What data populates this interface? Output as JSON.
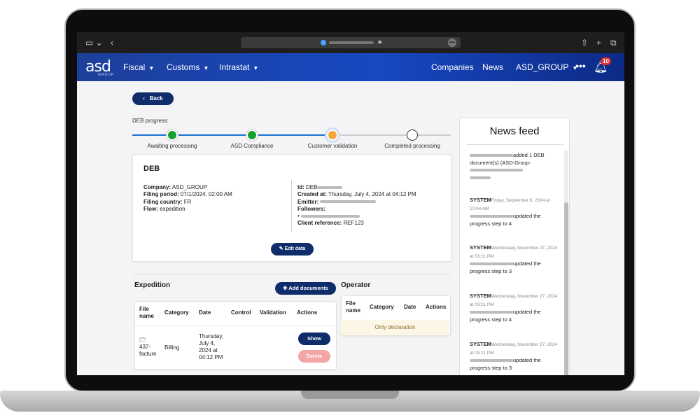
{
  "nav": {
    "logo": "asd",
    "logo_sub": "GROUP",
    "fiscal": "Fiscal",
    "customs": "Customs",
    "intrastat": "Intrastat",
    "companies": "Companies",
    "news": "News",
    "group": "ASD_GROUP",
    "more": "•••",
    "notifications": "10"
  },
  "page": {
    "back": "Back",
    "progress_label": "DEB progress:",
    "steps": [
      {
        "label": "Awaiting processing",
        "state": "done",
        "color": "#14a02e"
      },
      {
        "label": "ASD Compliance",
        "state": "done",
        "color": "#14a02e"
      },
      {
        "label": "Customer validation",
        "state": "current",
        "color": "#f5a63c"
      },
      {
        "label": "Completed processing",
        "state": "todo",
        "color": "#ffffff"
      }
    ]
  },
  "deb": {
    "title": "DEB",
    "company_label": "Company:",
    "company": "ASD_GROUP",
    "filing_period_label": "Filing period:",
    "filing_period": "07/1/2024, 02:00 AM",
    "filing_country_label": "Filing country:",
    "filing_country": "FR",
    "flow_label": "Flow:",
    "flow": "expedition",
    "id_label": "Id:",
    "id": "DEB",
    "created_label": "Created at:",
    "created": "Thursday, July 4, 2024 at 04:12 PM",
    "emitter_label": "Emitter:",
    "followers_label": "Followers:",
    "follower_bullet": "•",
    "client_ref_label": "Client reference:",
    "client_ref": "REF123",
    "edit": "Edit data"
  },
  "expedition": {
    "title": "Expedition",
    "add_documents": "Add documents",
    "headers": [
      "File name",
      "Category",
      "Date",
      "Control",
      "Validation",
      "Actions"
    ],
    "row": {
      "file_icon": "🗁",
      "file": "437-facture",
      "category": "Billing",
      "date": "Thursday, July 4, 2024 at 04:12 PM",
      "show": "Show",
      "delete": "Delete"
    }
  },
  "operator": {
    "title": "Operator",
    "headers": [
      "File name",
      "Category",
      "Date",
      "Actions"
    ],
    "empty": "Only declaration"
  },
  "feed": {
    "title": "News feed",
    "items": [
      {
        "actor": "",
        "text": "added 1 DEB document(s) (ASD-Group-",
        "date": ""
      },
      {
        "actor": "SYSTEM",
        "date": "Friday, September 6, 2024 at 10:04 AM",
        "text": "updated the progress step to 4"
      },
      {
        "actor": "SYSTEM",
        "date": "Wednesday, November 27, 2024 at 03:11 PM",
        "text": "updated the progress step to 3"
      },
      {
        "actor": "SYSTEM",
        "date": "Wednesday, November 27, 2024 at 03:11 PM",
        "text": "updated the progress step to 4"
      },
      {
        "actor": "SYSTEM",
        "date": "Wednesday, November 27, 2024 at 03:11 PM",
        "text": "updated the progress step to 3"
      }
    ]
  }
}
